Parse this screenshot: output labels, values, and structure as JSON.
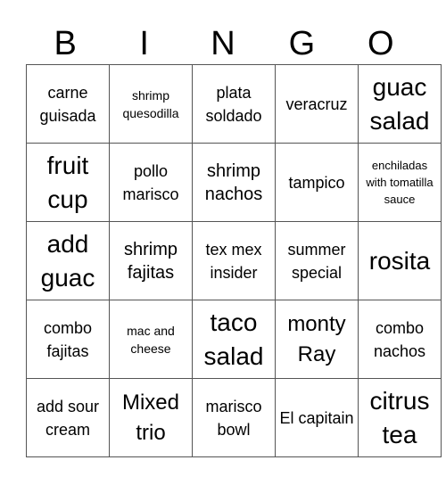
{
  "header": [
    "B",
    "I",
    "N",
    "G",
    "O"
  ],
  "cells": [
    [
      {
        "text": "carne guisada",
        "size": "s2"
      },
      {
        "text": "shrimp quesodilla",
        "size": "s1"
      },
      {
        "text": "plata soldado",
        "size": "s2"
      },
      {
        "text": "veracruz",
        "size": "s2"
      },
      {
        "text": "guac salad",
        "size": "s4"
      }
    ],
    [
      {
        "text": "fruit cup",
        "size": "s4"
      },
      {
        "text": "pollo marisco",
        "size": "s2"
      },
      {
        "text": "shrimp nachos",
        "size": "s3"
      },
      {
        "text": "tampico",
        "size": "s2"
      },
      {
        "text": "enchiladas with tomatilla sauce",
        "size": "s6"
      }
    ],
    [
      {
        "text": "add guac",
        "size": "s4"
      },
      {
        "text": "shrimp fajitas",
        "size": "s3"
      },
      {
        "text": "tex mex insider",
        "size": "s2"
      },
      {
        "text": "summer special",
        "size": "s2"
      },
      {
        "text": "rosita",
        "size": "s4"
      }
    ],
    [
      {
        "text": "combo fajitas",
        "size": "s2"
      },
      {
        "text": "mac and cheese",
        "size": "s1"
      },
      {
        "text": "taco salad",
        "size": "s4"
      },
      {
        "text": "monty Ray",
        "size": "s5"
      },
      {
        "text": "combo nachos",
        "size": "s2"
      }
    ],
    [
      {
        "text": "add sour cream",
        "size": "s2"
      },
      {
        "text": "Mixed trio",
        "size": "s5"
      },
      {
        "text": "marisco bowl",
        "size": "s2"
      },
      {
        "text": "El capitain",
        "size": "s2"
      },
      {
        "text": "citrus tea",
        "size": "s4"
      }
    ]
  ]
}
